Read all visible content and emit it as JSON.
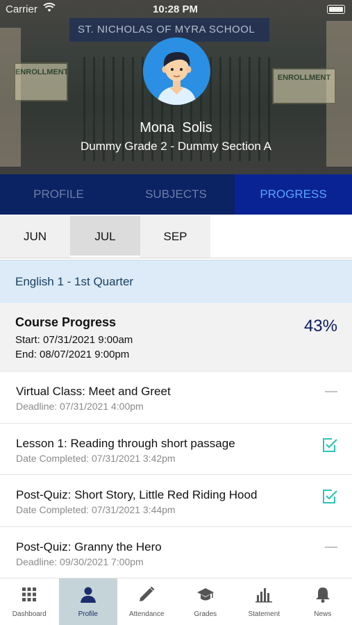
{
  "status_bar": {
    "carrier": "Carrier",
    "time": "10:28 PM"
  },
  "header": {
    "school_sign": "ST. NICHOLAS OF MYRA SCHOOL",
    "student_name": "Mona  Solis",
    "grade_section": "Dummy Grade 2 - Dummy Section A"
  },
  "tabs": [
    {
      "label": "PROFILE",
      "active": false
    },
    {
      "label": "SUBJECTS",
      "active": false
    },
    {
      "label": "PROGRESS",
      "active": true
    }
  ],
  "months": [
    {
      "label": "JUN",
      "selected": false
    },
    {
      "label": "JUL",
      "selected": true
    },
    {
      "label": "SEP",
      "selected": false
    }
  ],
  "course": {
    "title": "English 1 - 1st Quarter"
  },
  "progress": {
    "heading": "Course Progress",
    "start": "Start: 07/31/2021 9:00am",
    "end": "End: 08/07/2021 9:00pm",
    "percent": "43%"
  },
  "activities": [
    {
      "title": "Virtual Class: Meet and Greet",
      "detail": "Deadline: 07/31/2021 4:00pm",
      "status": "pending",
      "icon": "dash-icon"
    },
    {
      "title": "Lesson 1: Reading through short passage",
      "detail": "Date Completed: 07/31/2021 3:42pm",
      "status": "completed",
      "icon": "checkbox-checked-icon"
    },
    {
      "title": "Post-Quiz: Short Story, Little Red Riding Hood",
      "detail": "Date Completed: 07/31/2021 3:44pm",
      "status": "completed",
      "icon": "checkbox-checked-icon"
    },
    {
      "title": "Post-Quiz: Granny the Hero",
      "detail": "Deadline: 09/30/2021 7:00pm",
      "status": "pending",
      "icon": "dash-icon"
    }
  ],
  "bottom_nav": [
    {
      "label": "Dashboard",
      "icon": "grid-icon",
      "active": false
    },
    {
      "label": "Profile",
      "icon": "person-icon",
      "active": true
    },
    {
      "label": "Attendance",
      "icon": "pencil-icon",
      "active": false
    },
    {
      "label": "Grades",
      "icon": "graduation-cap-icon",
      "active": false
    },
    {
      "label": "Statement",
      "icon": "bar-chart-icon",
      "active": false
    },
    {
      "label": "News",
      "icon": "bell-icon",
      "active": false
    }
  ],
  "colors": {
    "tab_bar": "#0b2263",
    "tab_active": "#0a2394",
    "tab_active_text": "#58a4ff",
    "check_teal": "#2ec4b6",
    "course_bar": "#dcebf7",
    "percent_text": "#0a1a5e"
  }
}
